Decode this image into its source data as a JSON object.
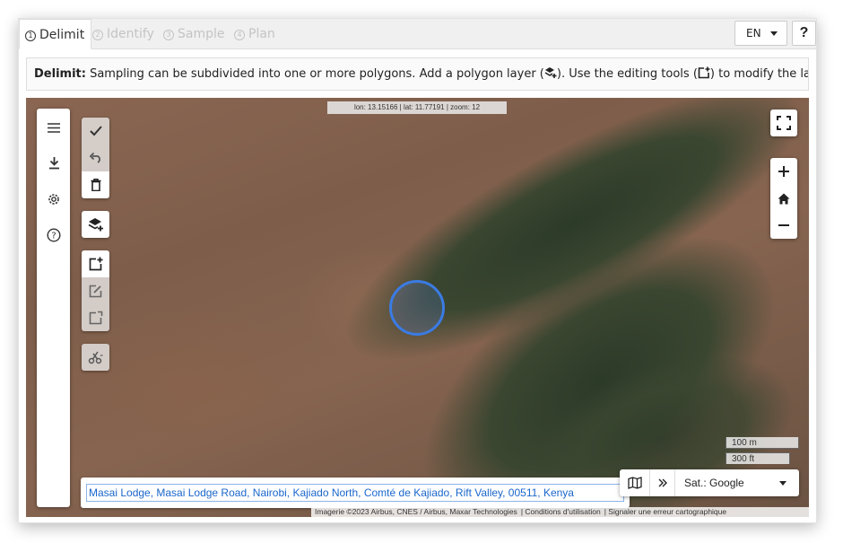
{
  "tabs": [
    {
      "num": "1",
      "label": "Delimit",
      "active": true
    },
    {
      "num": "2",
      "label": "Identify",
      "active": false
    },
    {
      "num": "3",
      "label": "Sample",
      "active": false
    },
    {
      "num": "4",
      "label": "Plan",
      "active": false
    }
  ],
  "header": {
    "language": "EN",
    "help_label": "?"
  },
  "message": {
    "bold": "Delimit:",
    "text1": " Sampling can be subdivided into one or more polygons. Add a polygon layer (",
    "text2": "). Use the editing tools (",
    "text3": ") to modify the layer. Fina"
  },
  "map": {
    "coordinates": "lon: 13.15166 | lat: 11.77191 | zoom: 12",
    "scale_metric": "100 m",
    "scale_imperial": "300 ft",
    "address": "Masai Lodge, Masai Lodge Road, Nairobi, Kajiado North, Comté de Kajiado, Rift Valley, 00511, Kenya",
    "source_label": "Sat.: Google",
    "attribution": [
      "Imagerie ©2023 Airbus, CNES / Airbus, Maxar Technologies",
      "Conditions d'utilisation",
      "Signaler une erreur cartographique"
    ],
    "selection_color": "#3a7be4"
  }
}
